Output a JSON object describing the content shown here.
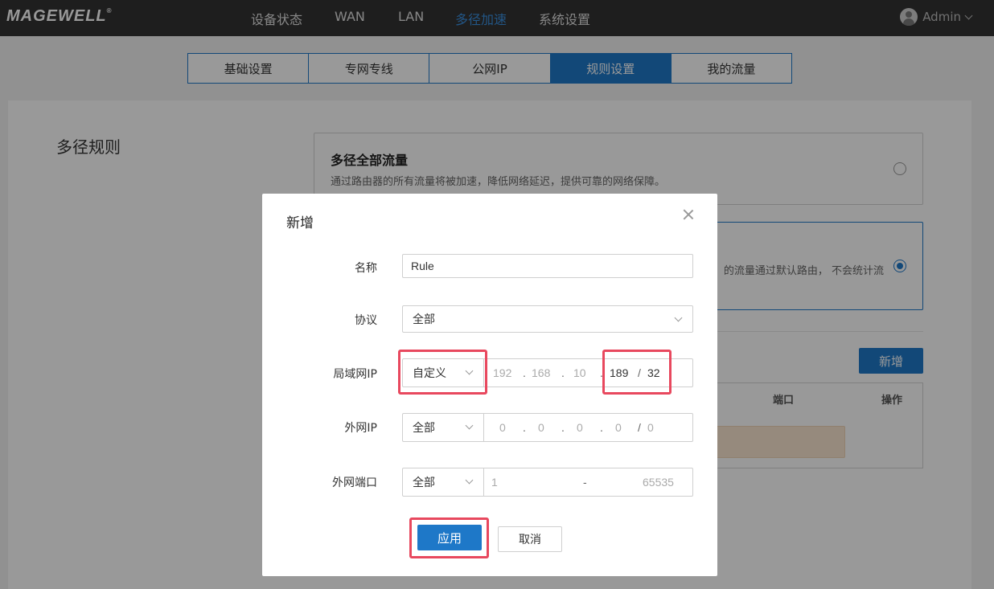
{
  "brand": {
    "logo": "MAGEWELL",
    "mark": "®"
  },
  "nav": {
    "items": [
      {
        "label": "设备状态",
        "active": false
      },
      {
        "label": "WAN",
        "active": false
      },
      {
        "label": "LAN",
        "active": false
      },
      {
        "label": "多径加速",
        "active": true
      },
      {
        "label": "系统设置",
        "active": false
      }
    ],
    "user": "Admin"
  },
  "tabs": [
    {
      "label": "基础设置",
      "active": false
    },
    {
      "label": "专网专线",
      "active": false
    },
    {
      "label": "公网IP",
      "active": false
    },
    {
      "label": "规则设置",
      "active": true
    },
    {
      "label": "我的流量",
      "active": false
    }
  ],
  "page": {
    "section_title": "多径规则",
    "card1": {
      "title": "多径全部流量",
      "desc": "通过路由器的所有流量将被加速，降低网络延迟，提供可靠的网络保障。"
    },
    "card2": {
      "desc": "的流量通过默认路由， 不会统计流"
    },
    "add_button": "新增",
    "table_headers": {
      "port": "端口",
      "op": "操作"
    }
  },
  "modal": {
    "title": "新增",
    "fields": {
      "name": {
        "label": "名称",
        "value": "Rule"
      },
      "protocol": {
        "label": "协议",
        "value": "全部"
      },
      "lan_ip": {
        "label": "局域网IP",
        "mode": "自定义",
        "octets": [
          "192",
          "168",
          "10",
          "189"
        ],
        "mask": "32"
      },
      "wan_ip": {
        "label": "外网IP",
        "mode": "全部",
        "octets": [
          "0",
          "0",
          "0",
          "0"
        ],
        "mask": "0"
      },
      "wan_port": {
        "label": "外网端口",
        "mode": "全部",
        "from": "1",
        "sep": "-",
        "to": "65535"
      }
    },
    "apply": "应用",
    "cancel": "取消"
  },
  "colors": {
    "accent": "#1e78c8",
    "highlight": "#e8485e",
    "topbar": "#333333"
  }
}
